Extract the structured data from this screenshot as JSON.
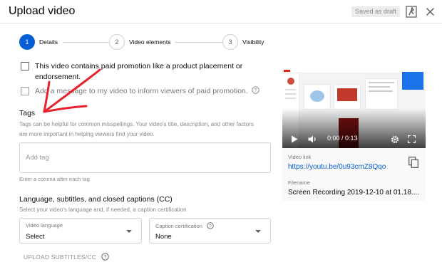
{
  "header": {
    "title": "Upload video",
    "saved_label": "Saved as draft"
  },
  "stepper": {
    "steps": [
      {
        "number": "1",
        "label": "Details",
        "active": true
      },
      {
        "number": "2",
        "label": "Video elements",
        "active": false
      },
      {
        "number": "3",
        "label": "Visibility",
        "active": false
      }
    ]
  },
  "paid_promotion": {
    "label": "This video contains paid promotion like a product placement or endorsement.",
    "checked": false
  },
  "paid_message": {
    "label": "Add a message to my video to inform viewers of paid promotion.",
    "checked": false
  },
  "tags": {
    "title": "Tags",
    "description": "Tags can be helpful for common misspellings. Your video's title, description, and other factors are more important in helping viewers find your video.",
    "placeholder": "Add tag",
    "value": "",
    "hint": "Enter a comma after each tag"
  },
  "language": {
    "title": "Language, subtitles, and closed captions (CC)",
    "description": "Select your video's language and, if needed, a caption certification",
    "video_language_label": "Video language",
    "video_language_value": "Select",
    "caption_cert_label": "Caption certification",
    "caption_cert_value": "None",
    "upload_subtitles_label": "UPLOAD SUBTITLES/CC"
  },
  "preview": {
    "time": "0:00 / 0:13",
    "video_link_label": "Video link",
    "video_link": "https://youtu.be/0u93cmZ8Qqo",
    "filename_label": "Filename",
    "filename": "Screen Recording 2019-12-10 at 01.18...."
  },
  "colors": {
    "accent": "#065fd4",
    "annotation_arrow": "#e8212b"
  },
  "icons": {
    "feedback": "feedback-icon",
    "close": "close-icon",
    "help": "help-icon",
    "copy": "copy-icon",
    "play": "play-icon",
    "volume": "volume-icon",
    "settings": "gear-icon",
    "fullscreen": "fullscreen-icon",
    "caret": "chevron-down-icon"
  }
}
